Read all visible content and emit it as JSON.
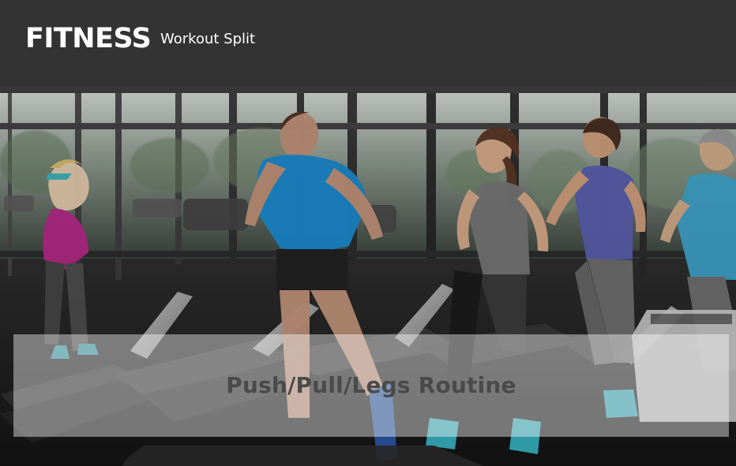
{
  "header": {
    "brand": "FITNESS",
    "nav_link": "Workout Split"
  },
  "hero": {
    "caption": "Push/Pull/Legs Routine"
  },
  "colors": {
    "header_bg": "#333333",
    "header_text": "#ffffff",
    "caption_text": "#4a4a4a",
    "accent_blue": "#1f8fd6",
    "accent_magenta": "#c0268f",
    "accent_teal": "#3fc0c8"
  }
}
